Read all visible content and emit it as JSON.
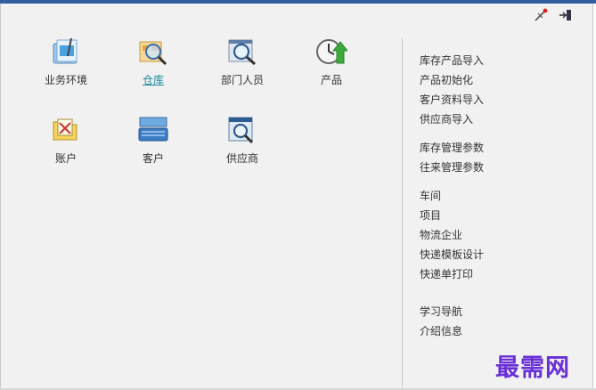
{
  "colors": {
    "accent": "#2f5f9e",
    "active_link": "#1a8a9c",
    "watermark": "#6a2fd6"
  },
  "toolbar": {
    "icons": [
      "pin-icon",
      "exit-icon"
    ]
  },
  "modules": [
    {
      "label": "业务环境",
      "icon": "clipboard-tools-icon",
      "active": false
    },
    {
      "label": "仓库",
      "icon": "warehouse-magnifier-icon",
      "active": true
    },
    {
      "label": "部门人员",
      "icon": "department-magnifier-icon",
      "active": false
    },
    {
      "label": "产品",
      "icon": "clock-arrow-icon",
      "active": false
    },
    {
      "label": "账户",
      "icon": "account-folder-icon",
      "active": false
    },
    {
      "label": "客户",
      "icon": "customer-keyboard-icon",
      "active": false
    },
    {
      "label": "供应商",
      "icon": "supplier-window-icon",
      "active": false
    }
  ],
  "menu": {
    "groups": [
      [
        "库存产品导入",
        "产品初始化",
        "客户资料导入",
        "供应商导入"
      ],
      [
        "库存管理参数",
        "往来管理参数"
      ],
      [
        "车间",
        "项目",
        "物流企业",
        "快递模板设计",
        "快递单打印"
      ],
      [
        "学习导航",
        "介绍信息"
      ]
    ]
  },
  "watermark": "最需网"
}
